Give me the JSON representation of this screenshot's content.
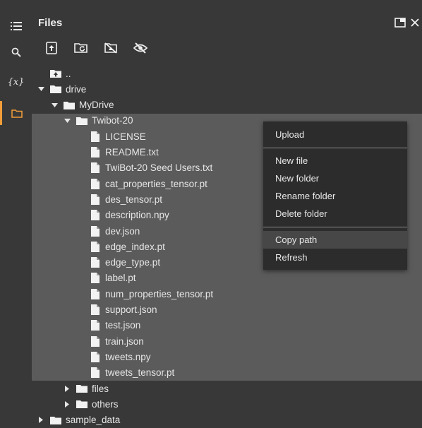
{
  "panel": {
    "title": "Files"
  },
  "rail": {
    "variables_label": "{x}"
  },
  "tree": [
    {
      "label": "..",
      "kind": "parent",
      "level": 0
    },
    {
      "label": "drive",
      "kind": "folder",
      "level": 0,
      "expanded": true
    },
    {
      "label": "MyDrive",
      "kind": "folder",
      "level": 1,
      "expanded": true
    },
    {
      "label": "Twibot-20",
      "kind": "folder",
      "level": 2,
      "expanded": true
    },
    {
      "label": "LICENSE",
      "kind": "file",
      "level": 3
    },
    {
      "label": "README.txt",
      "kind": "file",
      "level": 3
    },
    {
      "label": "TwiBot-20 Seed Users.txt",
      "kind": "file",
      "level": 3
    },
    {
      "label": "cat_properties_tensor.pt",
      "kind": "file",
      "level": 3
    },
    {
      "label": "des_tensor.pt",
      "kind": "file",
      "level": 3
    },
    {
      "label": "description.npy",
      "kind": "file",
      "level": 3
    },
    {
      "label": "dev.json",
      "kind": "file",
      "level": 3
    },
    {
      "label": "edge_index.pt",
      "kind": "file",
      "level": 3
    },
    {
      "label": "edge_type.pt",
      "kind": "file",
      "level": 3
    },
    {
      "label": "label.pt",
      "kind": "file",
      "level": 3
    },
    {
      "label": "num_properties_tensor.pt",
      "kind": "file",
      "level": 3
    },
    {
      "label": "support.json",
      "kind": "file",
      "level": 3
    },
    {
      "label": "test.json",
      "kind": "file",
      "level": 3
    },
    {
      "label": "train.json",
      "kind": "file",
      "level": 3
    },
    {
      "label": "tweets.npy",
      "kind": "file",
      "level": 3
    },
    {
      "label": "tweets_tensor.pt",
      "kind": "file",
      "level": 3
    },
    {
      "label": "files",
      "kind": "folder",
      "level": 2,
      "expanded": false
    },
    {
      "label": "others",
      "kind": "folder",
      "level": 2,
      "expanded": false
    },
    {
      "label": "sample_data",
      "kind": "folder",
      "level": 0,
      "expanded": false
    }
  ],
  "context_menu": {
    "upload": "Upload",
    "new_file": "New file",
    "new_folder": "New folder",
    "rename_folder": "Rename folder",
    "delete_folder": "Delete folder",
    "copy_path": "Copy path",
    "refresh": "Refresh"
  },
  "colors": {
    "accent": "#f29d38",
    "selection": "#5b5b5b",
    "menu_bg": "#2c2c2c"
  }
}
